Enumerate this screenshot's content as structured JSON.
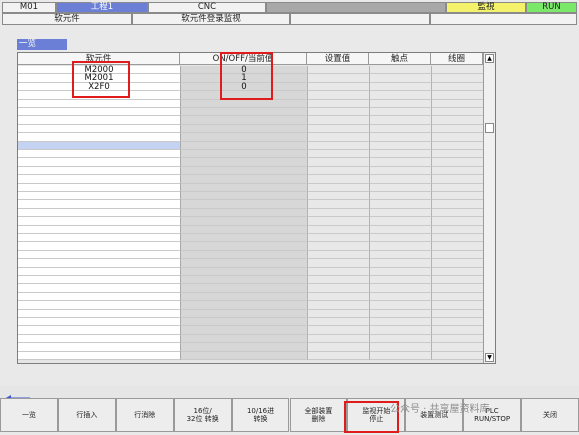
{
  "top": {
    "program": "M01",
    "tab_active": "工程1",
    "mode": "CNC",
    "monitor_status": "監視",
    "run_status": "RUN"
  },
  "header2": {
    "left": "软元件",
    "center": "软元件登录监视"
  },
  "list_tab": "一览",
  "table": {
    "columns": [
      "软元件",
      "ON/OFF/当前值",
      "设置值",
      "触点",
      "线圈"
    ],
    "rows": [
      {
        "device": "M2000",
        "value": "0"
      },
      {
        "device": "M2001",
        "value": "1"
      },
      {
        "device": "X2F0",
        "value": "0"
      }
    ]
  },
  "buttons": [
    {
      "l1": "一览",
      "l2": ""
    },
    {
      "l1": "行插入",
      "l2": ""
    },
    {
      "l1": "行消除",
      "l2": ""
    },
    {
      "l1": "16位/",
      "l2": "32位 转换"
    },
    {
      "l1": "10/16进",
      "l2": "转换"
    },
    {
      "l1": "全部装置",
      "l2": "删除"
    },
    {
      "l1": "监视开始",
      "l2": "停止"
    },
    {
      "l1": "装置测试",
      "l2": ""
    },
    {
      "l1": "PLC",
      "l2": "RUN/STOP"
    },
    {
      "l1": "关闭",
      "l2": ""
    }
  ],
  "watermark": "公众号 · 共享屋资料库",
  "colors": {
    "active_tab": "#6b7fd7",
    "monitor": "#f3f26a",
    "run": "#7be86a",
    "highlight_row": "#c5d3f2",
    "red_box": "#e01b1b"
  }
}
